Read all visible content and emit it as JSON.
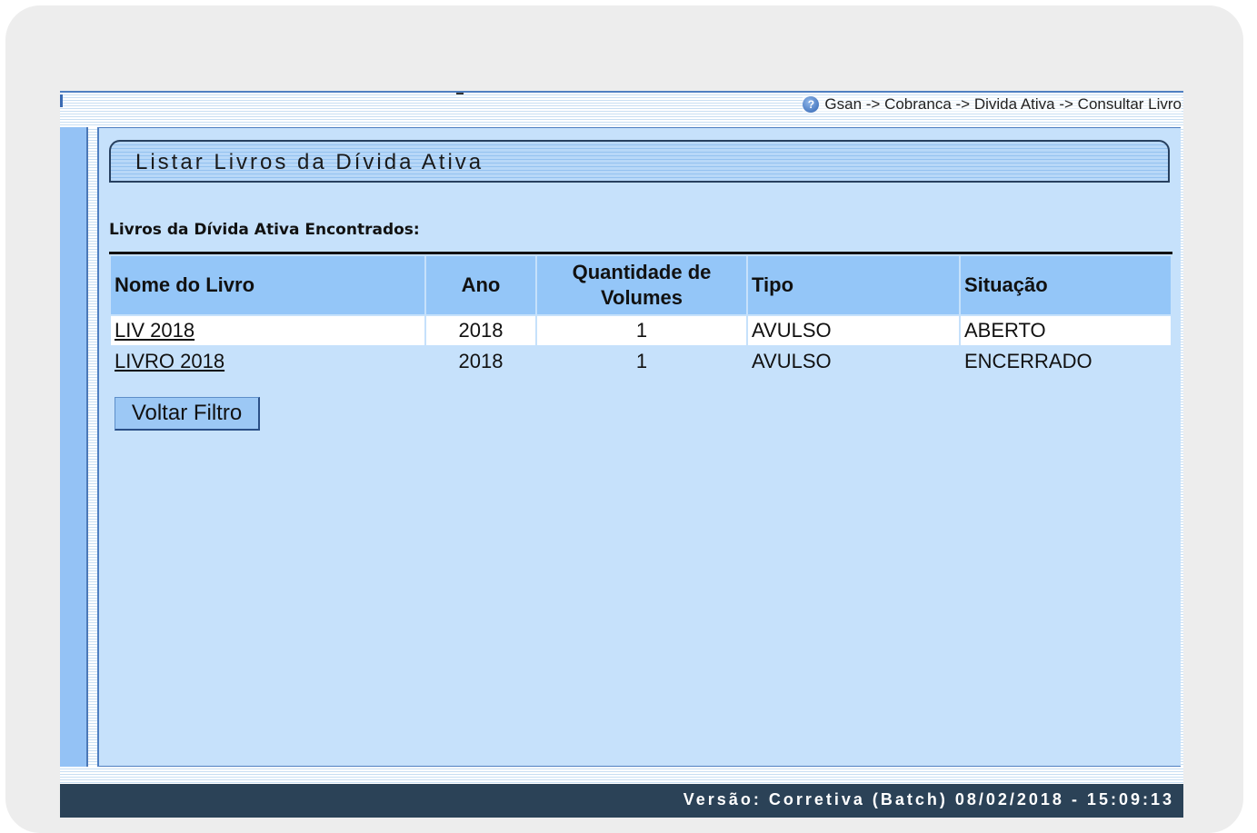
{
  "breadcrumb": {
    "text": "Gsan -> Cobranca -> Divida Ativa -> Consultar Livro",
    "help_icon": "help-icon"
  },
  "page": {
    "title": "Listar Livros da Dívida Ativa",
    "found_label": "Livros da Dívida Ativa Encontrados:"
  },
  "table": {
    "headers": {
      "nome": "Nome do Livro",
      "ano": "Ano",
      "quantidade": "Quantidade de Volumes",
      "tipo": "Tipo",
      "situacao": "Situação"
    },
    "rows": [
      {
        "nome": "LIV 2018",
        "ano": "2018",
        "quantidade": "1",
        "tipo": "AVULSO",
        "situacao": "ABERTO"
      },
      {
        "nome": "LIVRO 2018",
        "ano": "2018",
        "quantidade": "1",
        "tipo": "AVULSO",
        "situacao": "ENCERRADO"
      }
    ]
  },
  "actions": {
    "back_label": "Voltar Filtro"
  },
  "footer": {
    "version": "Versão: Corretiva (Batch) 08/02/2018 - 15:09:13"
  },
  "colors": {
    "content_bg": "#c6e1fb",
    "header_bg": "#94c6f8",
    "footer_bg": "#2b4257"
  }
}
